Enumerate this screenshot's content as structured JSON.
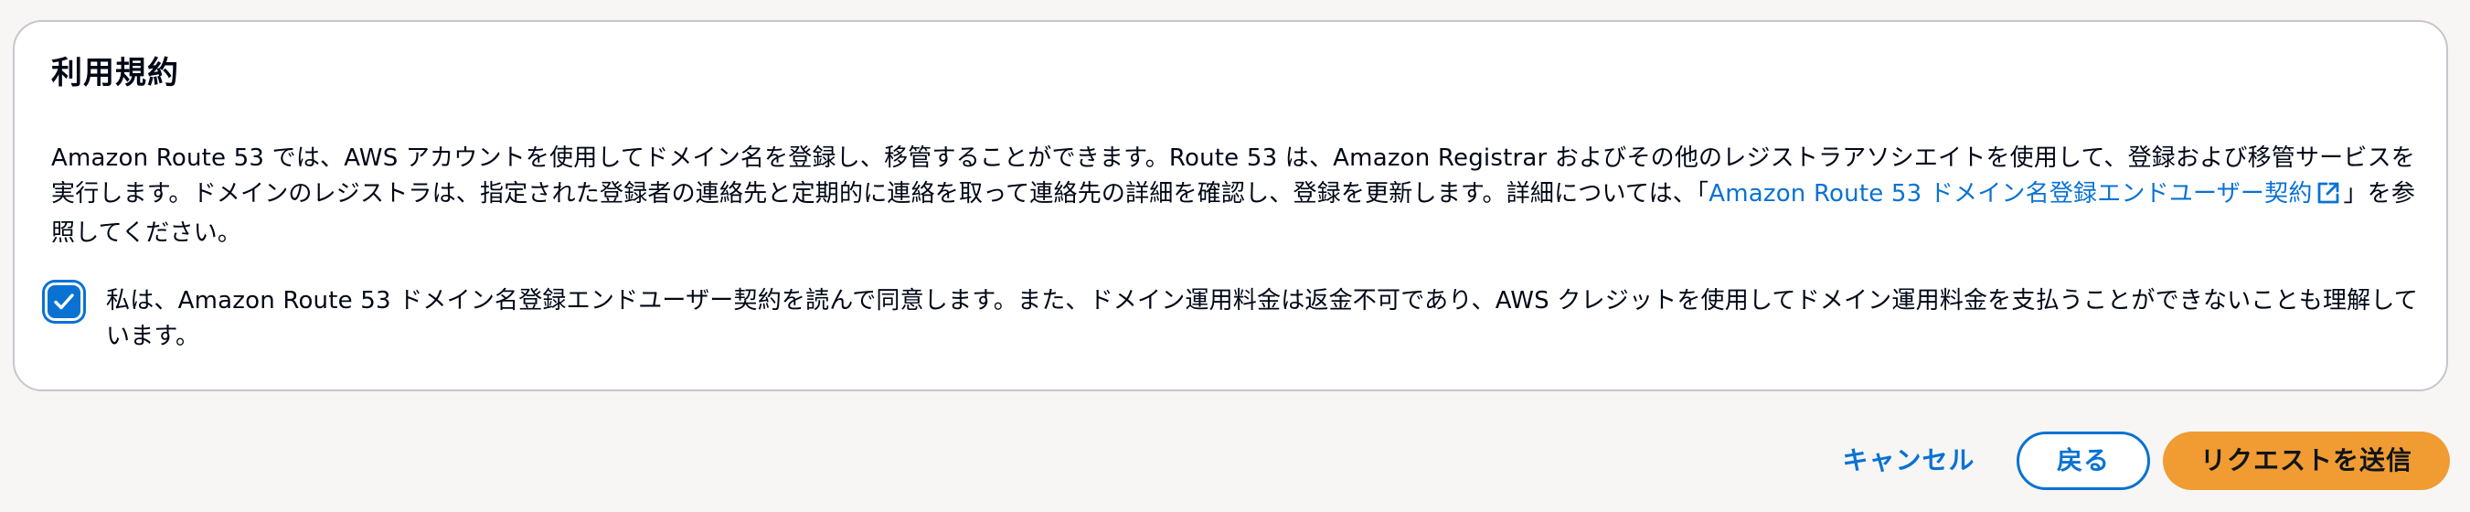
{
  "terms": {
    "title": "利用規約",
    "description": {
      "text_before_link": "Amazon Route 53 では、AWS アカウントを使用してドメイン名を登録し、移管することができます。Route 53 は、Amazon Registrar およびその他のレジストラアソシエイトを使用して、登録および移管サービスを実行します。ドメインのレジストラは、指定された登録者の連絡先と定期的に連絡を取って連絡先の詳細を確認し、登録を更新します。詳細については、「",
      "link_text": "Amazon Route 53 ドメイン名登録エンドユーザー契約",
      "text_after_link": "」を参照してください。",
      "link_icon": "external-link-icon"
    },
    "agreement": {
      "checked": true,
      "label": "私は、Amazon Route 53 ドメイン名登録エンドユーザー契約を読んで同意します。また、ドメイン運用料金は返金不可であり、AWS クレジットを使用してドメイン運用料金を支払うことができないことも理解しています。"
    }
  },
  "actions": {
    "cancel_label": "キャンセル",
    "back_label": "戻る",
    "submit_label": "リクエストを送信"
  },
  "colors": {
    "link": "#0972d3",
    "primary_button": "#f09c32",
    "checkbox": "#0972d3",
    "card_border": "#c6c6cd"
  }
}
